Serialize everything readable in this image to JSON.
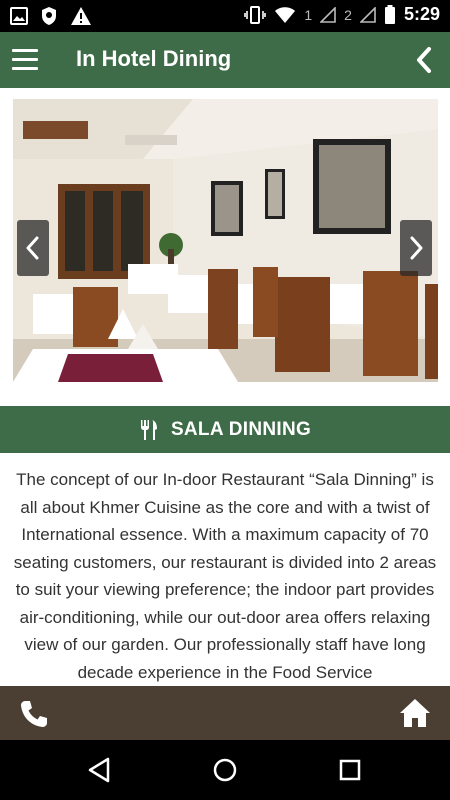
{
  "status_bar": {
    "time": "5:29",
    "sim1": "1",
    "sim2": "2",
    "icons": [
      "image-icon",
      "vpn-shield-icon",
      "warning-icon",
      "vibrate-icon",
      "wifi-icon",
      "signal-icon",
      "signal-icon",
      "battery-icon"
    ]
  },
  "app_bar": {
    "title": "In Hotel Dining",
    "menu_icon": "hamburger-menu-icon",
    "back_icon": "chevron-left-icon",
    "color": "#3e6b48"
  },
  "slider": {
    "image_description_icon": "restaurant-photo",
    "prev_icon": "chevron-left-icon",
    "next_icon": "chevron-right-icon"
  },
  "section": {
    "icon": "fork-knife-icon",
    "title": "SALA DINNING"
  },
  "description": "The concept of our In-door Restaurant “Sala Dinning” is all about Khmer Cuisine as the core and with a twist of International essence. With a maximum capacity of 70 seating customers, our restaurant is divided into 2 areas to suit your viewing preference; the indoor part provides air-conditioning, while our out-door area offers relaxing view of our garden. Our professionally staff have long decade experience in the Food Service",
  "bottom_bar": {
    "phone_icon": "phone-icon",
    "home_icon": "home-icon",
    "color": "#4a3f32"
  },
  "system_nav": {
    "back_icon": "triangle-back-icon",
    "home_icon": "circle-home-icon",
    "recents_icon": "square-recents-icon"
  }
}
